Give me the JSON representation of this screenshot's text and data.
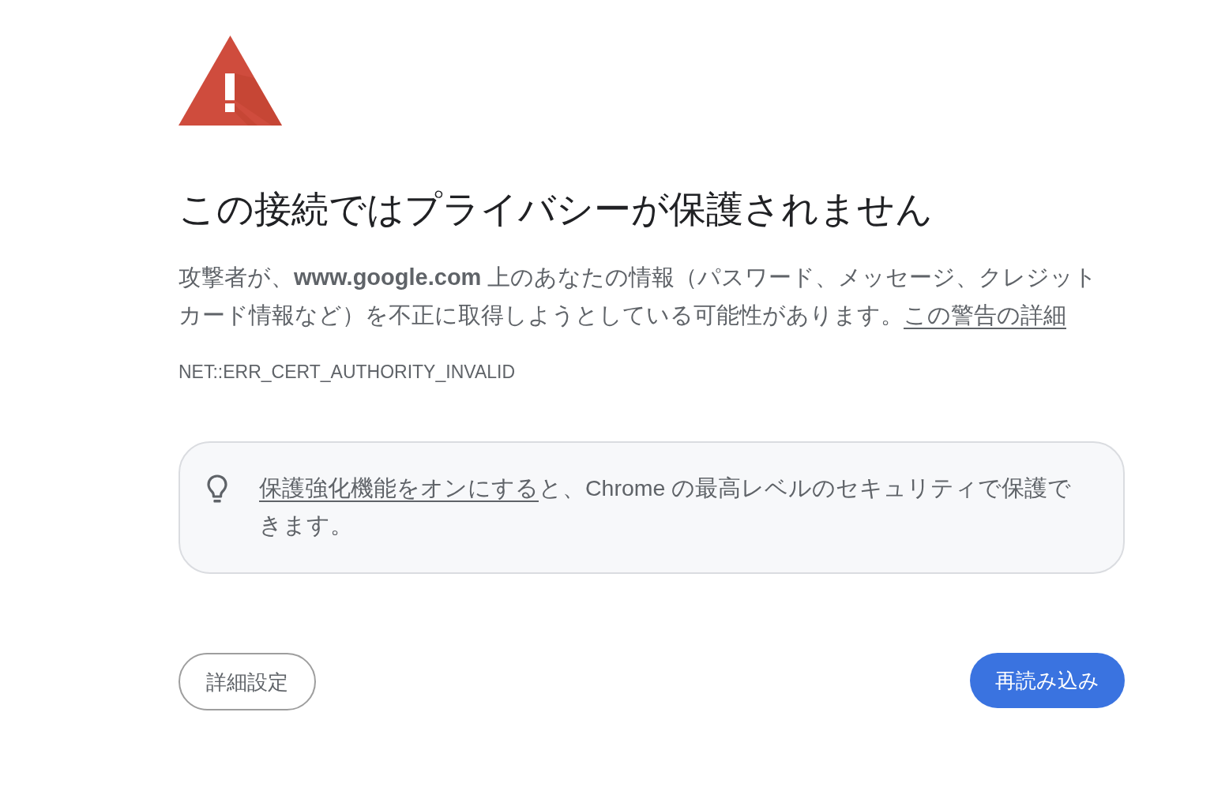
{
  "title": "この接続ではプライバシーが保護されません",
  "message": {
    "text": "攻撃者が、**www.google.com** 上のあなたの情報（パスワード、メッセージ、クレジットカード情報など）を不正に取得しようとしている可能性があります。",
    "link": "この警告の詳細"
  },
  "error_code": "NET::ERR_CERT_AUTHORITY_INVALID",
  "tip": {
    "link": "保護強化機能をオンにする",
    "text": "と、Chrome の最高レベルのセキュリティで保護できます。"
  },
  "buttons": [
    {
      "label": "詳細設定",
      "kind": "outlined"
    },
    {
      "label": "再読み込み",
      "kind": "filled"
    }
  ]
}
